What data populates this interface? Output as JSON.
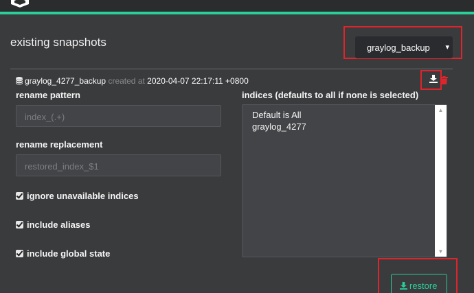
{
  "section_title": "existing snapshots",
  "repository_select": {
    "value": "graylog_backup"
  },
  "snapshot": {
    "name": "graylog_4277_backup",
    "created_label": "created at",
    "created_at": "2020-04-07 22:17:11 +0800"
  },
  "form": {
    "rename_pattern_label": "rename pattern",
    "rename_pattern_placeholder": "index_(.+)",
    "rename_replacement_label": "rename replacement",
    "rename_replacement_placeholder": "restored_index_$1",
    "ignore_unavailable_label": "ignore unavailable indices",
    "include_aliases_label": "include aliases",
    "include_global_state_label": "include global state",
    "indices_label": "indices (defaults to all if none is selected)",
    "indices_options": [
      "Default is All",
      "graylog_4277"
    ]
  },
  "restore_button": {
    "label": "restore"
  },
  "colors": {
    "accent": "#2bcf9a",
    "background": "#3a3b3d",
    "highlight_box": "#e0242b",
    "delete": "#e0242b"
  },
  "icons": [
    "database-icon",
    "download-icon",
    "trash-icon",
    "caret-down-icon",
    "checkbox-icon"
  ]
}
